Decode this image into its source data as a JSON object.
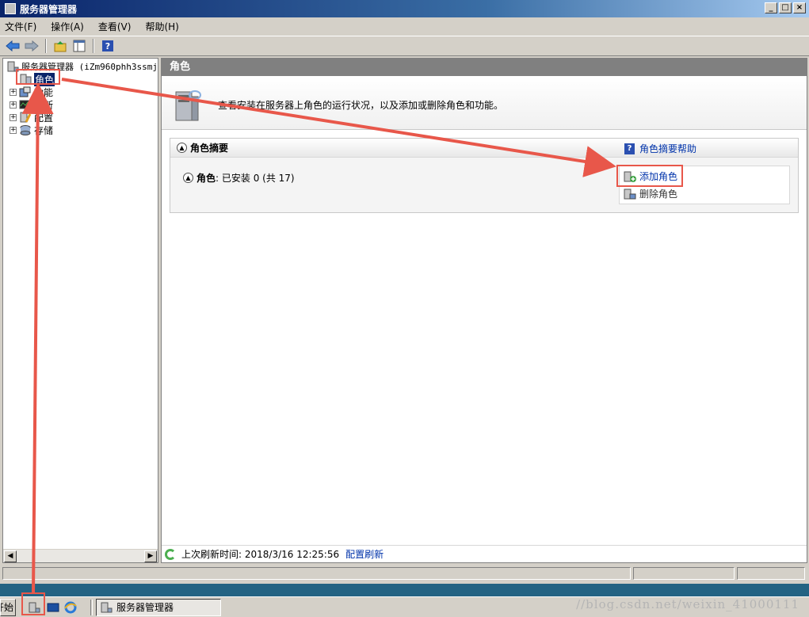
{
  "window": {
    "title": "服务器管理器"
  },
  "menu": [
    "文件(F)",
    "操作(A)",
    "查看(V)",
    "帮助(H)"
  ],
  "tree": {
    "root": "服务器管理器 (iZm960phh3ssmj",
    "items": [
      "角色",
      "功能",
      "诊断",
      "配置",
      "存储"
    ]
  },
  "pane": {
    "header": "角色",
    "intro": "查看安装在服务器上角色的运行状况，以及添加或删除角色和功能。",
    "summary_title": "角色摘要",
    "help_link": "角色摘要帮助",
    "roles_label": "角色",
    "roles_status": ": 已安装 0 (共 17)",
    "actions": {
      "add": "添加角色",
      "remove": "删除角色"
    },
    "refresh_label": "上次刷新时间: 2018/3/16 12:25:56",
    "refresh_link": "配置刷新"
  },
  "taskbar": {
    "start": "开始",
    "task": "服务器管理器"
  },
  "watermark": "//blog.csdn.net/weixin_41000111",
  "colors": {
    "annotation": "#e8574a",
    "link": "#0033aa",
    "selection": "#0a246a"
  }
}
